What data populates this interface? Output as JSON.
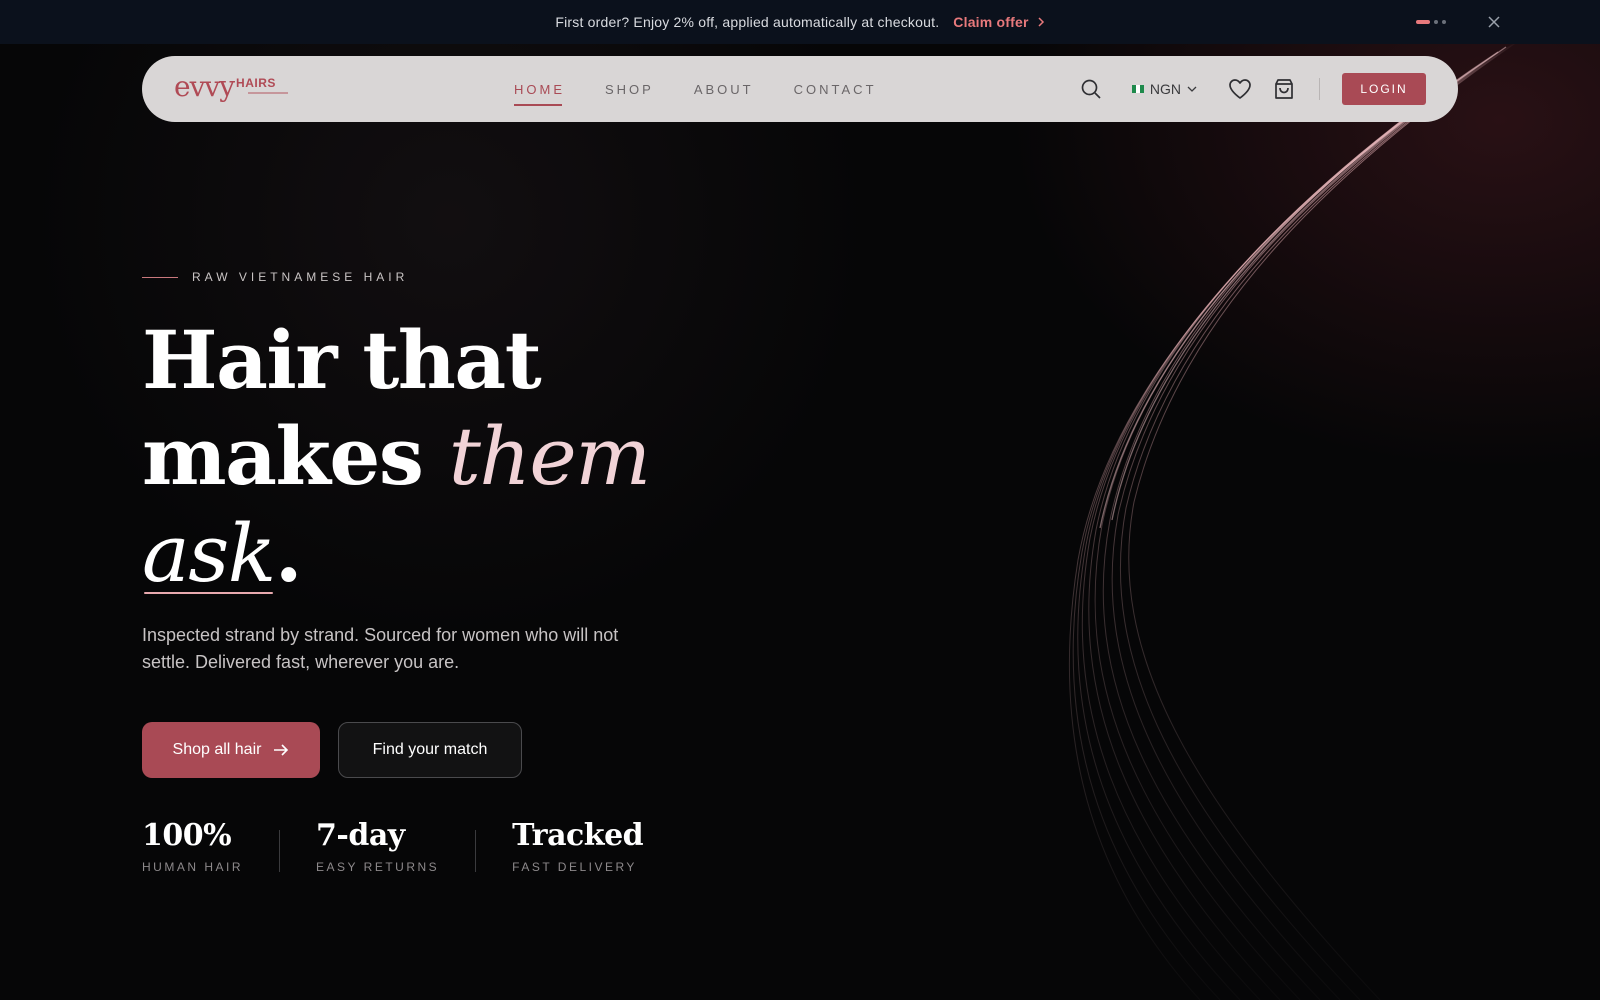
{
  "announcement": {
    "text": "First order? Enjoy 2% off, applied automatically at checkout.",
    "link_label": "Claim offer",
    "slides": 3,
    "active_slide": 1
  },
  "nav": {
    "logo_main": "evvy",
    "logo_sub": "HAIRS",
    "items": [
      {
        "label": "HOME",
        "active": true
      },
      {
        "label": "SHOP",
        "active": false
      },
      {
        "label": "ABOUT",
        "active": false
      },
      {
        "label": "CONTACT",
        "active": false
      }
    ],
    "currency": "NGN",
    "login_label": "LOGIN"
  },
  "hero": {
    "eyebrow": "RAW VIETNAMESE HAIR",
    "headline_line1": "Hair that",
    "headline_line2": "makes ",
    "headline_em": "them",
    "headline_ask": "ask",
    "headline_period": ".",
    "lead": "Inspected strand by strand. Sourced for women who will not settle. Delivered fast, wherever you are.",
    "cta_primary": "Shop all hair",
    "cta_secondary": "Find your match"
  },
  "stats": [
    {
      "value": "100%",
      "label": "HUMAN HAIR"
    },
    {
      "value": "7-day",
      "label": "EASY RETURNS"
    },
    {
      "value": "Tracked",
      "label": "FAST DELIVERY"
    }
  ],
  "colors": {
    "accent": "#a94a55",
    "accent_light": "#e8797c",
    "nav_bg": "#d9d6d6",
    "announcement_bg": "#0b111c",
    "page_bg": "#060607"
  }
}
